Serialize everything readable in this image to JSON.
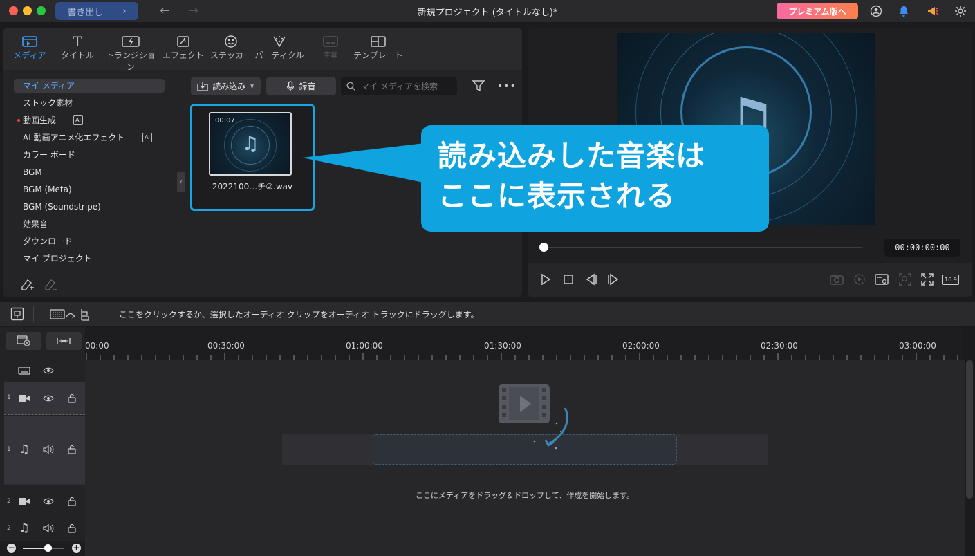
{
  "titlebar": {
    "export_label": "書き出し",
    "window_title": "新規プロジェクト (タイトルなし)*",
    "premium_label": "プレミアム版へ"
  },
  "media_tabs": [
    {
      "label": "メディア",
      "icon": "media-icon",
      "active": true
    },
    {
      "label": "タイトル",
      "icon": "title-icon"
    },
    {
      "label": "トランジション",
      "icon": "transition-icon"
    },
    {
      "label": "エフェクト",
      "icon": "effect-icon"
    },
    {
      "label": "ステッカー",
      "icon": "sticker-icon"
    },
    {
      "label": "パーティクル",
      "icon": "particle-icon"
    },
    {
      "label": "字幕",
      "icon": "subtitle-icon",
      "disabled": true
    },
    {
      "label": "テンプレート",
      "icon": "template-icon"
    }
  ],
  "categories": [
    {
      "label": "マイ メディア",
      "active": true
    },
    {
      "label": "ストック素材"
    },
    {
      "label": "動画生成",
      "new_dot": true,
      "ai_badge": "AI"
    },
    {
      "label": "AI 動画アニメ化エフェクト",
      "ai_badge": "AI"
    },
    {
      "label": "カラー ボード"
    },
    {
      "label": "BGM"
    },
    {
      "label": "BGM (Meta)"
    },
    {
      "label": "BGM (Soundstripe)"
    },
    {
      "label": "効果音"
    },
    {
      "label": "ダウンロード"
    },
    {
      "label": "マイ プロジェクト"
    }
  ],
  "media_toolbar": {
    "import_label": "読み込み",
    "record_label": "録音",
    "search_placeholder": "マイ メディアを検索"
  },
  "media_item": {
    "duration": "00:07",
    "name": "2022100…チ②.wav"
  },
  "callout": {
    "line1": "読み込みした音楽は",
    "line2": "ここに表示される",
    "color": "#0fa4e0"
  },
  "preview": {
    "timecode": "00:00:00:00",
    "progress": 0,
    "aspect_label": "16:9"
  },
  "timeline": {
    "hint": "ここをクリックするか、選択したオーディオ クリップをオーディオ トラックにドラッグします。",
    "ruler": [
      "00:00",
      "00:30:00",
      "01:00:00",
      "01:30:00",
      "02:00:00",
      "02:30:00",
      "03:00:00"
    ],
    "tracks": [
      {
        "num": "1",
        "type": "video"
      },
      {
        "num": "1",
        "type": "audio"
      },
      {
        "num": "2",
        "type": "video"
      },
      {
        "num": "2",
        "type": "audio"
      }
    ],
    "drop_text": "ここにメディアをドラッグ＆ドロップして、作成を開始します。"
  },
  "colors": {
    "accent": "#3aa0ff",
    "highlight": "#18a5e3",
    "premium_start": "#f76aa0",
    "premium_end": "#fd7e4c"
  }
}
